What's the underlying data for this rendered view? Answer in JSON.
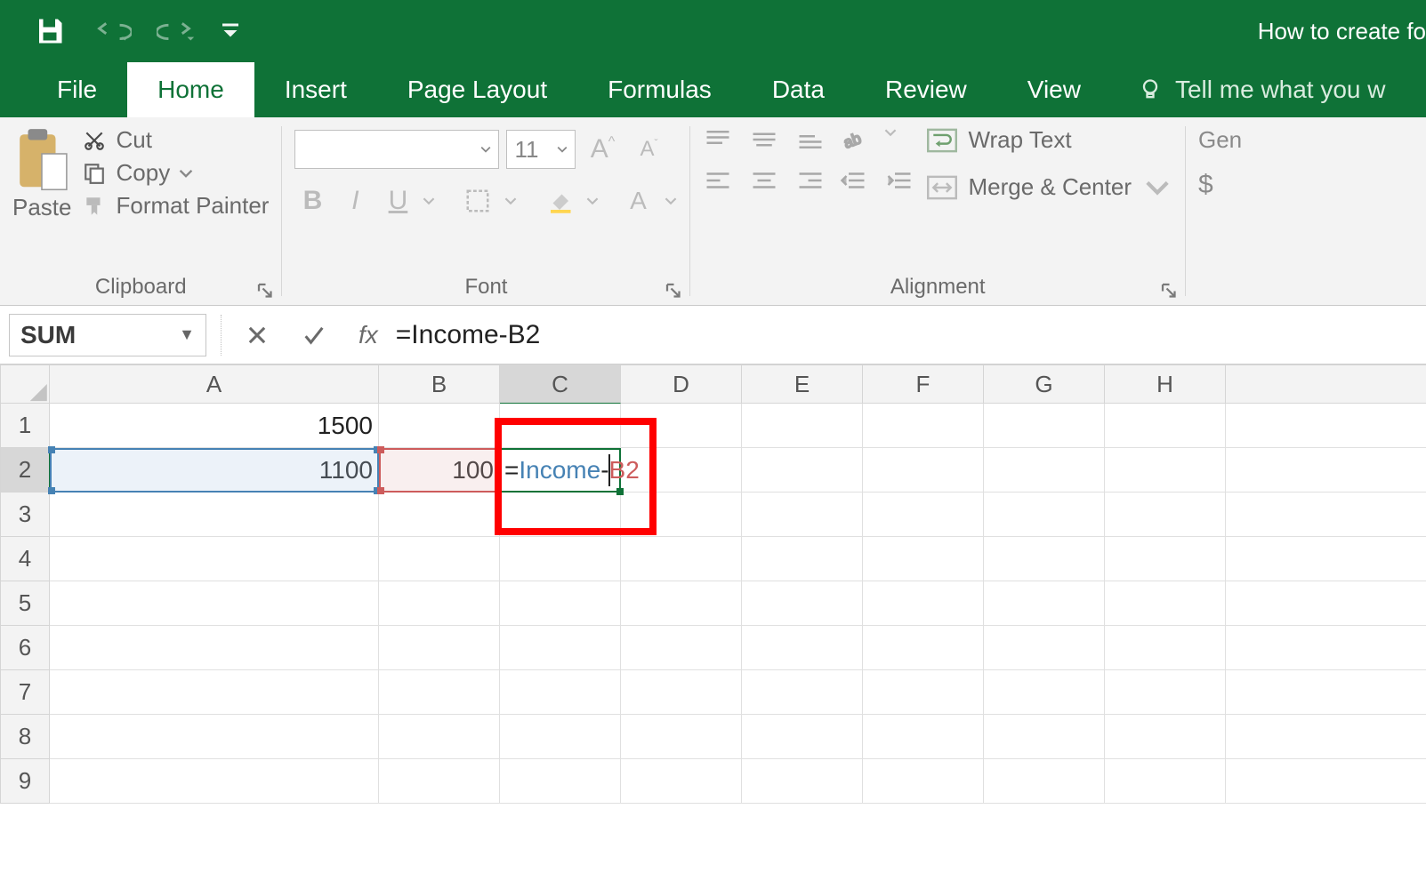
{
  "app": {
    "doc_title": "How to create fo"
  },
  "qat": {
    "save": "save-icon",
    "undo": "undo-icon",
    "redo": "redo-icon",
    "customize": "dropdown-icon"
  },
  "tabs": {
    "file": "File",
    "home": "Home",
    "insert": "Insert",
    "page_layout": "Page Layout",
    "formulas": "Formulas",
    "data": "Data",
    "review": "Review",
    "view": "View",
    "tell_me": "Tell me what you w"
  },
  "ribbon": {
    "clipboard": {
      "label": "Clipboard",
      "paste": "Paste",
      "cut": "Cut",
      "copy": "Copy",
      "format_painter": "Format Painter"
    },
    "font": {
      "label": "Font",
      "font_name": "",
      "font_size": "11",
      "bold": "B",
      "italic": "I",
      "underline": "U"
    },
    "alignment": {
      "label": "Alignment",
      "wrap_text": "Wrap Text",
      "merge_center": "Merge & Center"
    },
    "number": {
      "general": "Gen",
      "currency": "$"
    }
  },
  "formula_bar": {
    "name_box": "SUM",
    "cancel": "cancel-icon",
    "enter": "enter-icon",
    "fx": "fx",
    "formula": "=Income-B2"
  },
  "grid": {
    "columns": [
      "A",
      "B",
      "C",
      "D",
      "E",
      "F",
      "G",
      "H"
    ],
    "rows": [
      "1",
      "2",
      "3",
      "4",
      "5",
      "6",
      "7",
      "8",
      "9"
    ],
    "active_col": "C",
    "active_row": "2",
    "cells": {
      "A1": "1500",
      "A2": "1100",
      "B2": "100",
      "C2_raw": "=Income-B2",
      "C2_parts": {
        "eq": "=",
        "name": "Income",
        "minus": "-",
        "ref": "B2"
      }
    },
    "references": {
      "blue": "A2",
      "red": "B2",
      "editing": "C2"
    }
  }
}
